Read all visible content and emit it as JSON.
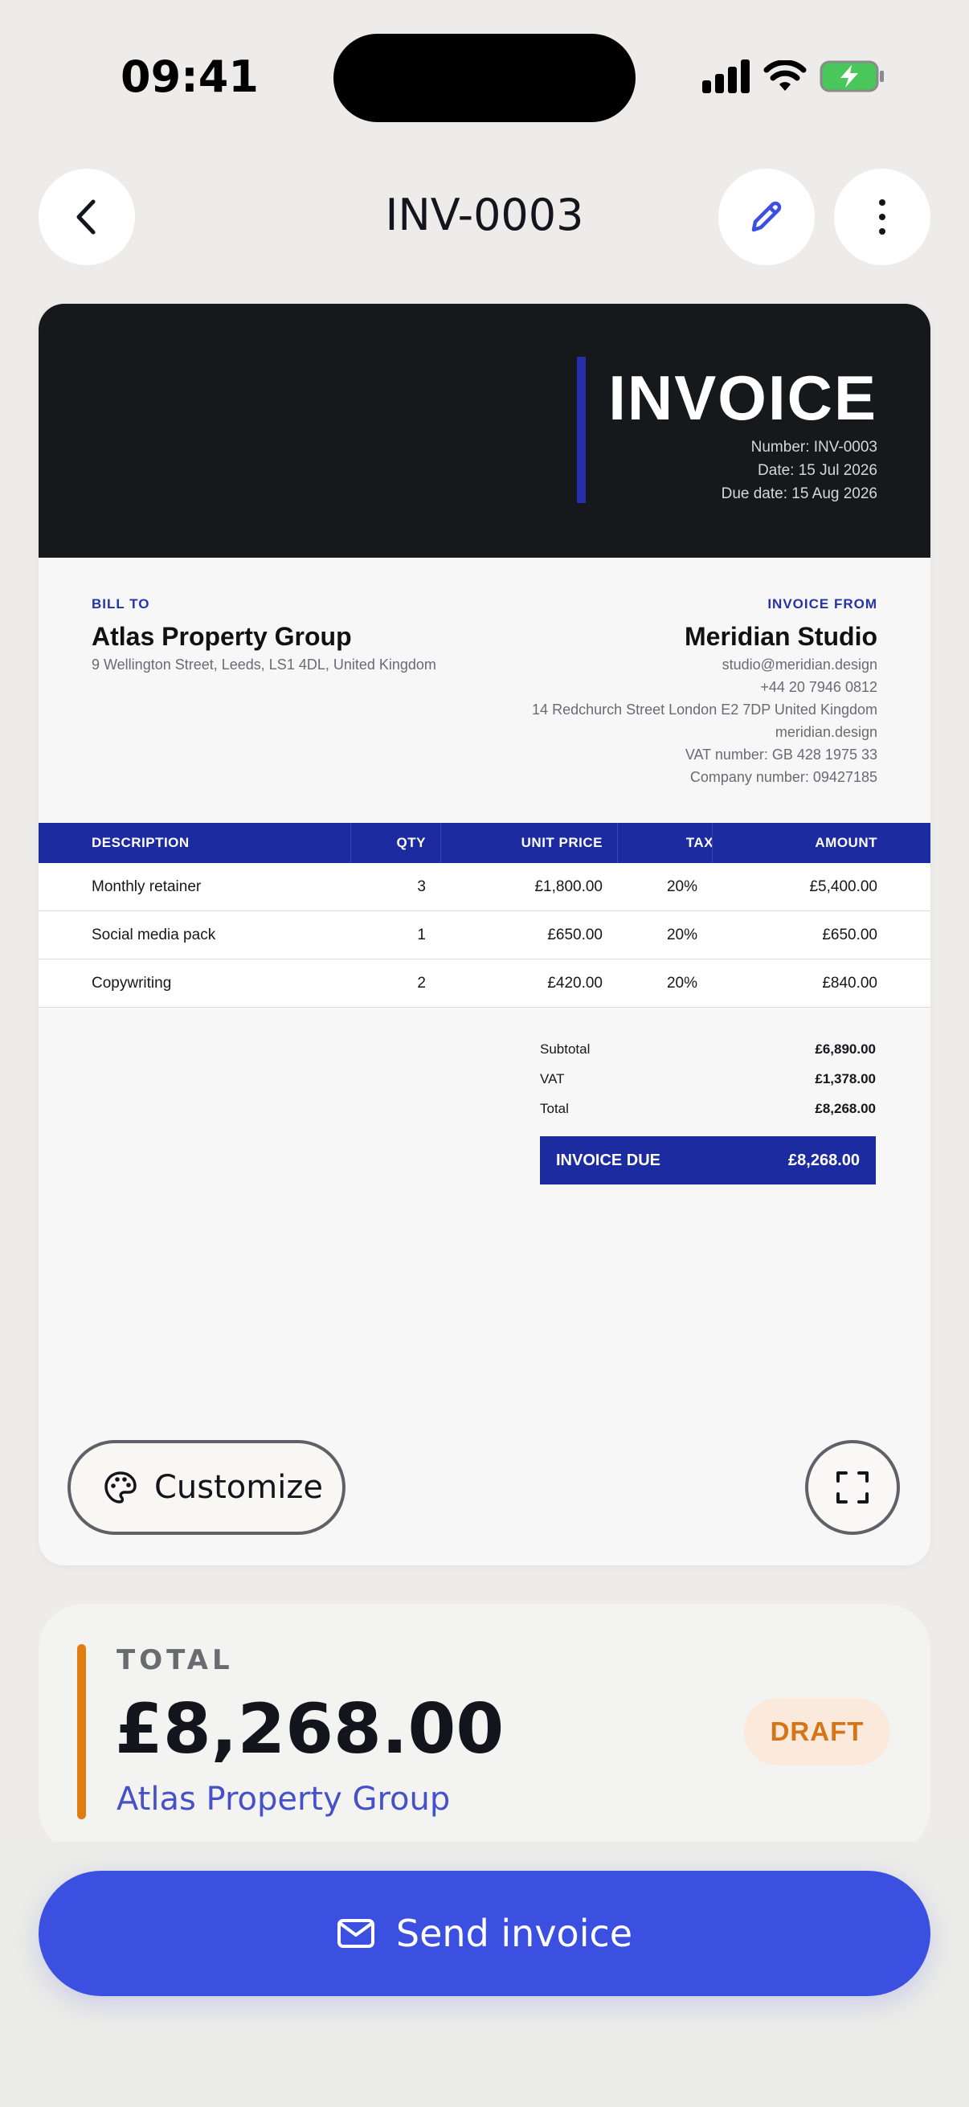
{
  "status_bar": {
    "time": "09:41"
  },
  "nav": {
    "title": "INV-0003"
  },
  "invoice": {
    "title": "INVOICE",
    "number_line": "Number: INV-0003",
    "date_line": "Date: 15 Jul 2026",
    "due_line": "Due date: 15 Aug 2026",
    "bill_to": {
      "label": "BILL TO",
      "name": "Atlas Property Group",
      "address": "9 Wellington Street, Leeds, LS1 4DL, United Kingdom"
    },
    "from": {
      "label": "INVOICE FROM",
      "name": "Meridian Studio",
      "lines": [
        "studio@meridian.design",
        "+44 20 7946 0812",
        "14 Redchurch Street London E2 7DP United Kingdom",
        "meridian.design",
        "VAT number: GB 428 1975 33",
        "Company number: 09427185"
      ]
    },
    "columns": {
      "description": "DESCRIPTION",
      "qty": "QTY",
      "unit_price": "UNIT PRICE",
      "tax": "TAX",
      "amount": "AMOUNT"
    },
    "items": [
      {
        "description": "Monthly retainer",
        "qty": "3",
        "unit_price": "£1,800.00",
        "tax": "20%",
        "amount": "£5,400.00"
      },
      {
        "description": "Social media pack",
        "qty": "1",
        "unit_price": "£650.00",
        "tax": "20%",
        "amount": "£650.00"
      },
      {
        "description": "Copywriting",
        "qty": "2",
        "unit_price": "£420.00",
        "tax": "20%",
        "amount": "£840.00"
      }
    ],
    "totals": {
      "subtotal_label": "Subtotal",
      "subtotal": "£6,890.00",
      "vat_label": "VAT",
      "vat": "£1,378.00",
      "total_label": "Total",
      "total": "£8,268.00"
    },
    "due": {
      "label": "INVOICE DUE",
      "value": "£8,268.00"
    }
  },
  "customize_label": "Customize",
  "summary": {
    "label": "TOTAL",
    "amount": "£8,268.00",
    "client": "Atlas Property Group",
    "status": "DRAFT"
  },
  "send_label": "Send invoice",
  "icons": [
    "back-chevron-icon",
    "edit-pencil-icon",
    "more-vertical-icon",
    "palette-icon",
    "expand-icon",
    "mail-icon",
    "signal-icon",
    "wifi-icon",
    "battery-icon"
  ],
  "colors": {
    "accent": "#3b4fe0",
    "invoice_blue": "#1d2ba0",
    "draft_orange": "#d5751a",
    "header_dark": "#17181b"
  }
}
